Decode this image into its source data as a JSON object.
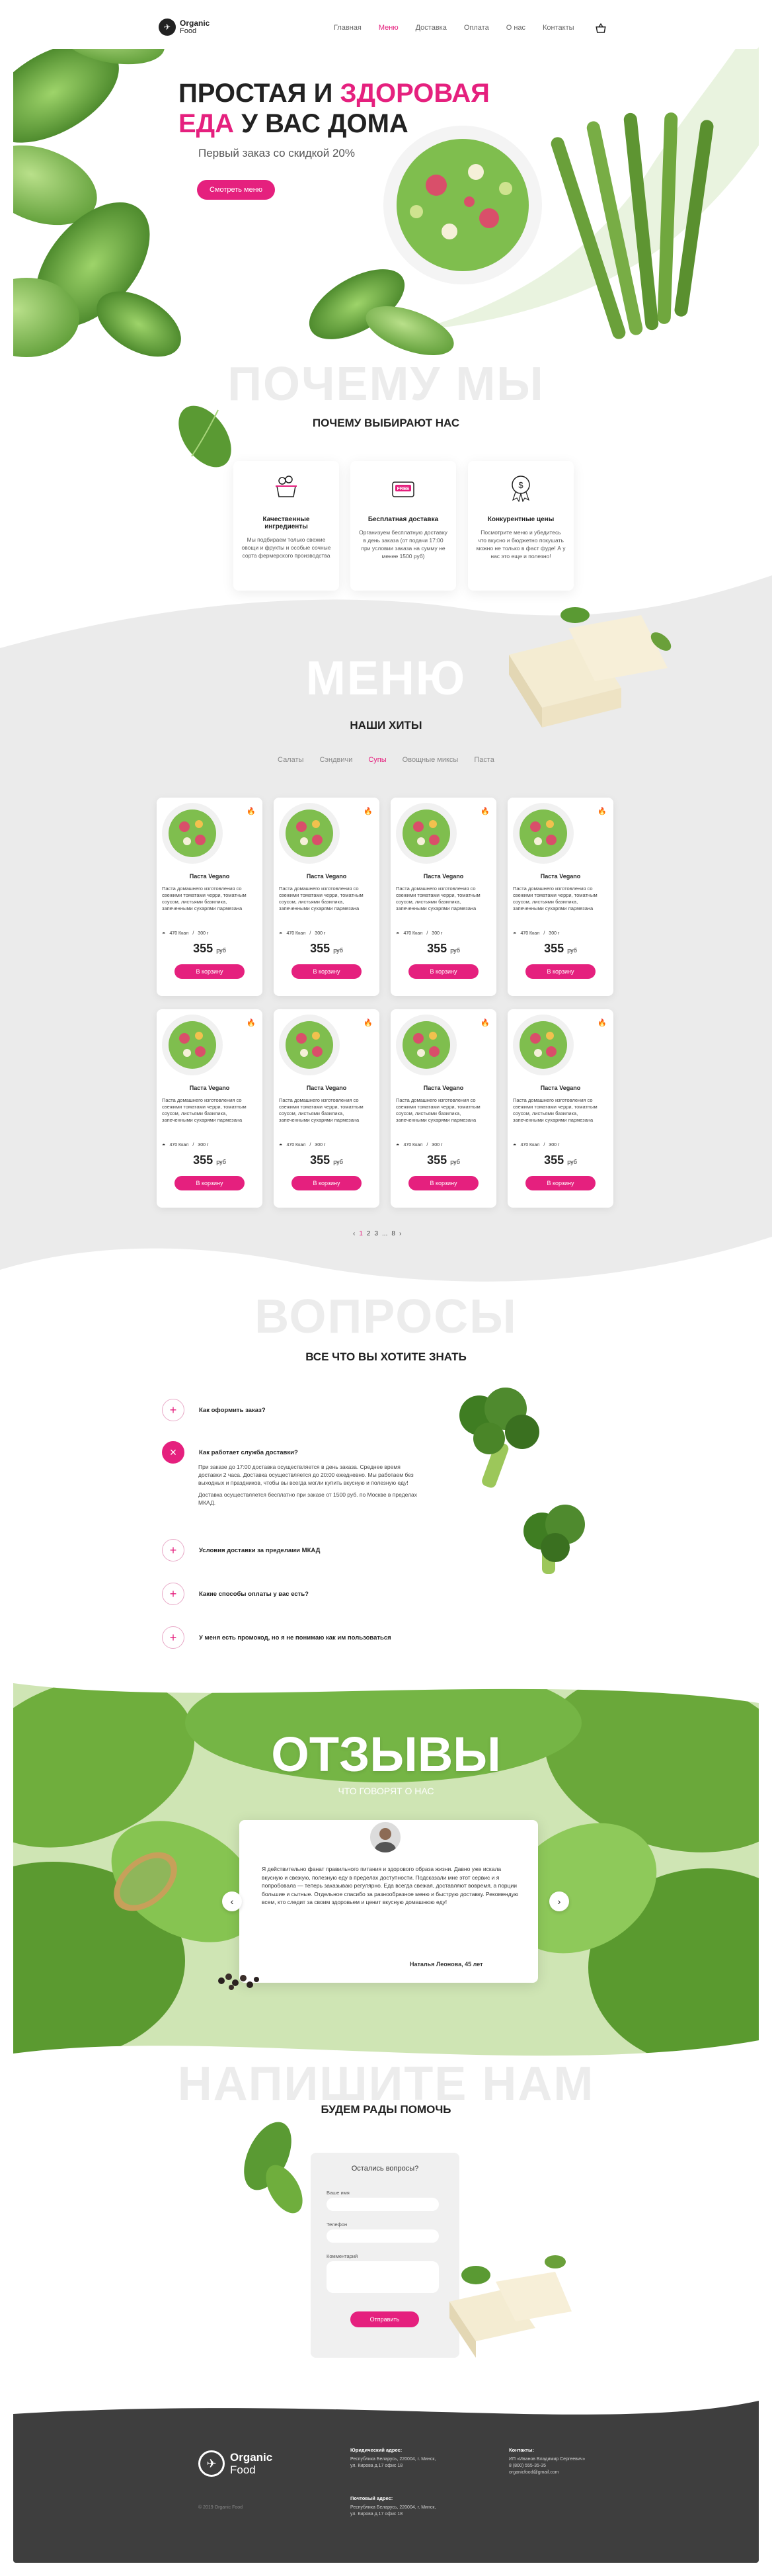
{
  "colors": {
    "accent": "#e5207e",
    "text": "#222222",
    "grey_bg": "#ebebeb",
    "footer_bg": "#3e3e3e",
    "green": "#4f8a2e"
  },
  "header": {
    "logo_line1": "Organic",
    "logo_line2": "Food",
    "nav": [
      "Главная",
      "Меню",
      "Доставка",
      "Оплата",
      "О нас",
      "Контакты"
    ],
    "active_nav": "Меню",
    "cart_icon": "basket-icon"
  },
  "hero": {
    "title_part1": "ПРОСТАЯ И ",
    "title_part2": "ЗДОРОВАЯ",
    "title_part3": "ЕДА",
    "title_part4": " У ВАС ДОМА",
    "subtitle": "Первый заказ со скидкой 20%",
    "button": "Смотреть меню"
  },
  "why": {
    "ghost": "ПОЧЕМУ МЫ",
    "title": "ПОЧЕМУ ВЫБИРАЮТ НАС",
    "cards": [
      {
        "icon": "basket-icon",
        "title": "Качественные ингредиенты",
        "text": "Мы подбираем только свежие овощи и фрукты и особые сочные сорта фермерского производства"
      },
      {
        "icon": "free-delivery-icon",
        "title": "Бесплатная доставка",
        "text": "Организуем бесплатную доставку в день заказа (от подачи 17:00 при условии заказа на сумму не менее 1500 руб)"
      },
      {
        "icon": "price-badge-icon",
        "title": "Конкурентные цены",
        "text": "Посмотрите меню и убедитесь что вкусно и бюджетно покушать можно не только в фаст фуде! А у нас это еще и полезно!"
      }
    ]
  },
  "menu": {
    "ghost": "МЕНЮ",
    "title": "НАШИ ХИТЫ",
    "tabs": [
      "Салаты",
      "Сэндвичи",
      "Супы",
      "Овощные миксы",
      "Паста"
    ],
    "active_tab": "Супы",
    "items": [
      {
        "name": "Паста Vegano",
        "desc": "Паста домашнего изготовления со свежими томатами черри, томатным соусом, листьями базилика, запеченными сухарями пармезана",
        "meta1": "470 Ккал",
        "meta2": "300 г",
        "price": "355",
        "currency": "руб",
        "button": "В корзину"
      },
      {
        "name": "Паста Vegano",
        "desc": "Паста домашнего изготовления со свежими томатами черри, томатным соусом, листьями базилика, запеченными сухарями пармезана",
        "meta1": "470 Ккал",
        "meta2": "300 г",
        "price": "355",
        "currency": "руб",
        "button": "В корзину"
      },
      {
        "name": "Паста Vegano",
        "desc": "Паста домашнего изготовления со свежими томатами черри, томатным соусом, листьями базилика, запеченными сухарями пармезана",
        "meta1": "470 Ккал",
        "meta2": "300 г",
        "price": "355",
        "currency": "руб",
        "button": "В корзину"
      },
      {
        "name": "Паста Vegano",
        "desc": "Паста домашнего изготовления со свежими томатами черри, томатным соусом, листьями базилика, запеченными сухарями пармезана",
        "meta1": "470 Ккал",
        "meta2": "300 г",
        "price": "355",
        "currency": "руб",
        "button": "В корзину"
      },
      {
        "name": "Паста Vegano",
        "desc": "Паста домашнего изготовления со свежими томатами черри, томатным соусом, листьями базилика, запеченными сухарями пармезана",
        "meta1": "470 Ккал",
        "meta2": "300 г",
        "price": "355",
        "currency": "руб",
        "button": "В корзину"
      },
      {
        "name": "Паста Vegano",
        "desc": "Паста домашнего изготовления со свежими томатами черри, томатным соусом, листьями базилика, запеченными сухарями пармезана",
        "meta1": "470 Ккал",
        "meta2": "300 г",
        "price": "355",
        "currency": "руб",
        "button": "В корзину"
      },
      {
        "name": "Паста Vegano",
        "desc": "Паста домашнего изготовления со свежими томатами черри, томатным соусом, листьями базилика, запеченными сухарями пармезана",
        "meta1": "470 Ккал",
        "meta2": "300 г",
        "price": "355",
        "currency": "руб",
        "button": "В корзину"
      },
      {
        "name": "Паста Vegano",
        "desc": "Паста домашнего изготовления со свежими томатами черри, томатным соусом, листьями базилика, запеченными сухарями пармезана",
        "meta1": "470 Ккал",
        "meta2": "300 г",
        "price": "355",
        "currency": "руб",
        "button": "В корзину"
      }
    ],
    "pager": [
      "‹",
      "1",
      "2",
      "3",
      "...",
      "8",
      "›"
    ],
    "active_page": "1"
  },
  "faq": {
    "ghost": "ВОПРОСЫ",
    "title": "ВСЕ ЧТО ВЫ ХОТИТЕ ЗНАТЬ",
    "items": [
      {
        "q": "Как оформить заказ?",
        "open": false
      },
      {
        "q": "Как работает служба доставки?",
        "open": true
      },
      {
        "q": "Условия доставки за пределами МКАД",
        "open": false
      },
      {
        "q": "Какие способы оплаты у вас есть?",
        "open": false
      },
      {
        "q": "У меня есть промокод, но я не понимаю как им пользоваться",
        "open": false
      }
    ],
    "answer_p1": "При заказе до 17:00 доставка осуществляется в день заказа. Среднее время доставки 2 часа. Доставка осуществляется до 20:00 ежедневно. Мы работаем без выходных и праздников, чтобы вы всегда могли купить вкусную и полезную еду!",
    "answer_p2": "Доставка осуществляется бесплатно при заказе от 1500 руб. по Москве в пределах МКАД."
  },
  "reviews": {
    "title": "ОТЗЫВЫ",
    "subtitle": "ЧТО ГОВОРЯТ О НАС",
    "text": "Я действительно фанат правильного питания и здорового образа жизни. Давно уже искала вкусную и свежую, полезную еду в пределах доступности. Подсказали мне этот сервис и я попробовала — теперь заказываю регулярно. Еда всегда свежая, доставляют вовремя, а порции большие и сытные. Отдельное спасибо за разнообразное меню и быструю доставку. Рекомендую всем, кто следит за своим здоровьем и ценит вкусную домашнюю еду!",
    "author": "Наталья Леонова, 45 лет",
    "prev": "‹",
    "next": "›"
  },
  "contact": {
    "ghost": "НАПИШИТЕ НАМ",
    "title": "БУДЕМ РАДЫ ПОМОЧЬ",
    "form_title": "Остались вопросы?",
    "label_name": "Ваше имя",
    "label_phone": "Телефон",
    "label_comment": "Комментарий",
    "button": "Отправить"
  },
  "footer": {
    "logo_line1": "Organic",
    "logo_line2": "Food",
    "copyright": "© 2019 Organic Food",
    "legal_title": "Юридический адрес:",
    "legal_text": "Республика Беларусь, 220004, г. Минск, ул. Кирова д.17 офис 18",
    "post_title": "Почтовый адрес:",
    "post_text": "Республика Беларусь, 220004, г. Минск, ул. Кирова д.17 офис 18",
    "contacts_title": "Контакты:",
    "contacts_person": "ИП «Иванов Владимир Сергеевич»",
    "contacts_phone": "8 (800) 555-35-35",
    "contacts_email": "organicfood@gmail.com"
  }
}
